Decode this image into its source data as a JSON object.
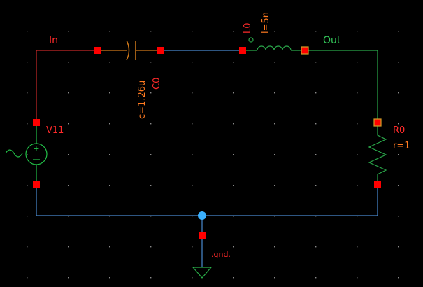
{
  "colors": {
    "background": "#000000",
    "grid": "#8a8a8a",
    "wire_red": "#c82828",
    "wire_blue": "#4a8ad0",
    "wire_green": "#2aa84a",
    "wire_orange": "#d27a1a",
    "pin": "#ff0000",
    "junction": "#3ab0ff",
    "label_red": "#ff2a2a",
    "label_orange": "#ff7a20",
    "label_green": "#33c85a",
    "source_symbol": "#22c048",
    "ground_symbol": "#2ab04a"
  },
  "schematic": {
    "nets": {
      "in": "In",
      "out": "Out",
      "gnd": ".gnd."
    },
    "components": {
      "source": {
        "name": "V11",
        "icon": "ac-voltage-source-icon"
      },
      "capacitor": {
        "name": "C0",
        "value": "c=1.26u",
        "icon": "capacitor-icon"
      },
      "inductor": {
        "name": "L0",
        "value": "l=5n",
        "icon": "inductor-icon"
      },
      "resistor": {
        "name": "R0",
        "value": "r=1",
        "icon": "resistor-icon"
      },
      "ground": {
        "icon": "ground-icon"
      }
    }
  }
}
